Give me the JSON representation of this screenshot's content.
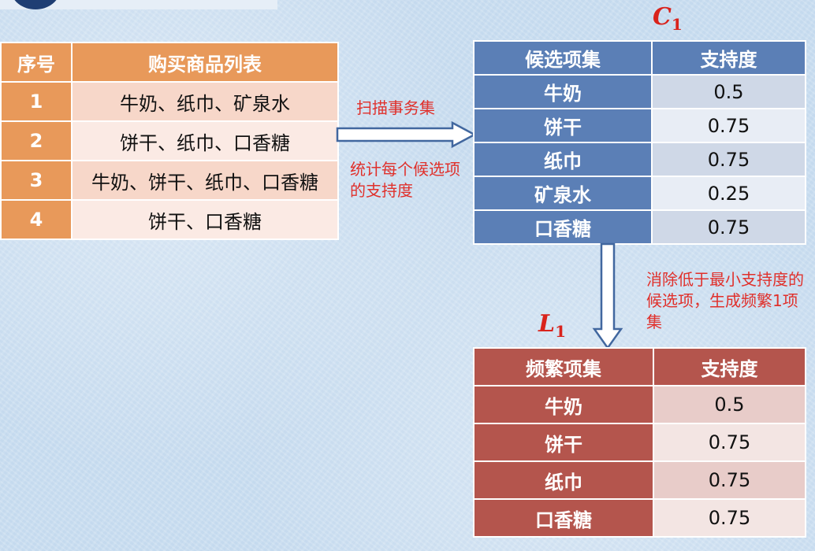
{
  "purchase_table": {
    "headers": [
      "序号",
      "购买商品列表"
    ],
    "rows": [
      {
        "id": "1",
        "items": "牛奶、纸巾、矿泉水"
      },
      {
        "id": "2",
        "items": "饼干、纸巾、口香糖"
      },
      {
        "id": "3",
        "items": "牛奶、饼干、纸巾、口香糖"
      },
      {
        "id": "4",
        "items": "饼干、口香糖"
      }
    ]
  },
  "arrow1": {
    "label_top": "扫描事务集",
    "label_bottom": "统计每个候选项的支持度"
  },
  "c1": {
    "label_main": "C",
    "label_sub": "1",
    "headers": [
      "候选项集",
      "支持度"
    ],
    "rows": [
      {
        "item": "牛奶",
        "support": "0.5"
      },
      {
        "item": "饼干",
        "support": "0.75"
      },
      {
        "item": "纸巾",
        "support": "0.75"
      },
      {
        "item": "矿泉水",
        "support": "0.25"
      },
      {
        "item": "口香糖",
        "support": "0.75"
      }
    ]
  },
  "arrow2": {
    "label": "消除低于最小支持度的候选项，生成频繁1项集"
  },
  "l1": {
    "label_main": "L",
    "label_sub": "1",
    "headers": [
      "频繁项集",
      "支持度"
    ],
    "rows": [
      {
        "item": "牛奶",
        "support": "0.5"
      },
      {
        "item": "饼干",
        "support": "0.75"
      },
      {
        "item": "纸巾",
        "support": "0.75"
      },
      {
        "item": "口香糖",
        "support": "0.75"
      }
    ]
  },
  "colors": {
    "purchase_header": "#e8995a",
    "candidate_header": "#5b7fb6",
    "frequent_header": "#b4554d",
    "annotation": "#e0302b"
  }
}
